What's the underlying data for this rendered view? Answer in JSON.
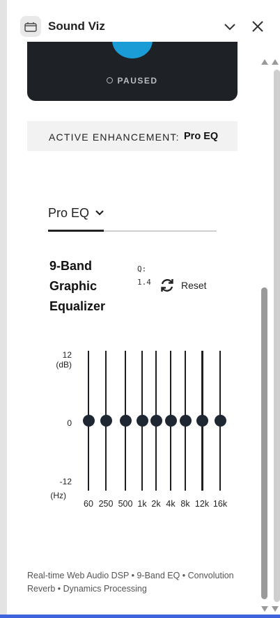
{
  "app": {
    "title": "Sound Viz"
  },
  "header": {
    "collapse_icon": "chevron-down-icon",
    "close_icon": "close-icon"
  },
  "player": {
    "status": "PAUSED",
    "accent": "#1a9cd6",
    "background": "#1e2126"
  },
  "enhancement": {
    "label": "ACTIVE ENHANCEMENT:",
    "value": "Pro EQ"
  },
  "selector": {
    "selected": "Pro EQ"
  },
  "eq": {
    "title_lines": [
      "9-Band",
      "Graphic",
      "Equalizer"
    ],
    "q_label": "Q:",
    "q_value": "1.4",
    "reset_label": "Reset",
    "y_top": "12",
    "y_top_unit": "(dB)",
    "y_mid": "0",
    "y_bottom": "-12",
    "x_unit": "(Hz)",
    "bands": [
      {
        "freq": "60",
        "gain_db": 0
      },
      {
        "freq": "250",
        "gain_db": 0
      },
      {
        "freq": "500",
        "gain_db": 0
      },
      {
        "freq": "1k",
        "gain_db": 0
      },
      {
        "freq": "2k",
        "gain_db": 0
      },
      {
        "freq": "4k",
        "gain_db": 0
      },
      {
        "freq": "8k",
        "gain_db": 0
      },
      {
        "freq": "12k",
        "gain_db": 0
      },
      {
        "freq": "16k",
        "gain_db": 0
      }
    ]
  },
  "footer": {
    "text": "Real-time Web Audio DSP • 9-Band EQ • Convolution Reverb • Dynamics Processing"
  }
}
